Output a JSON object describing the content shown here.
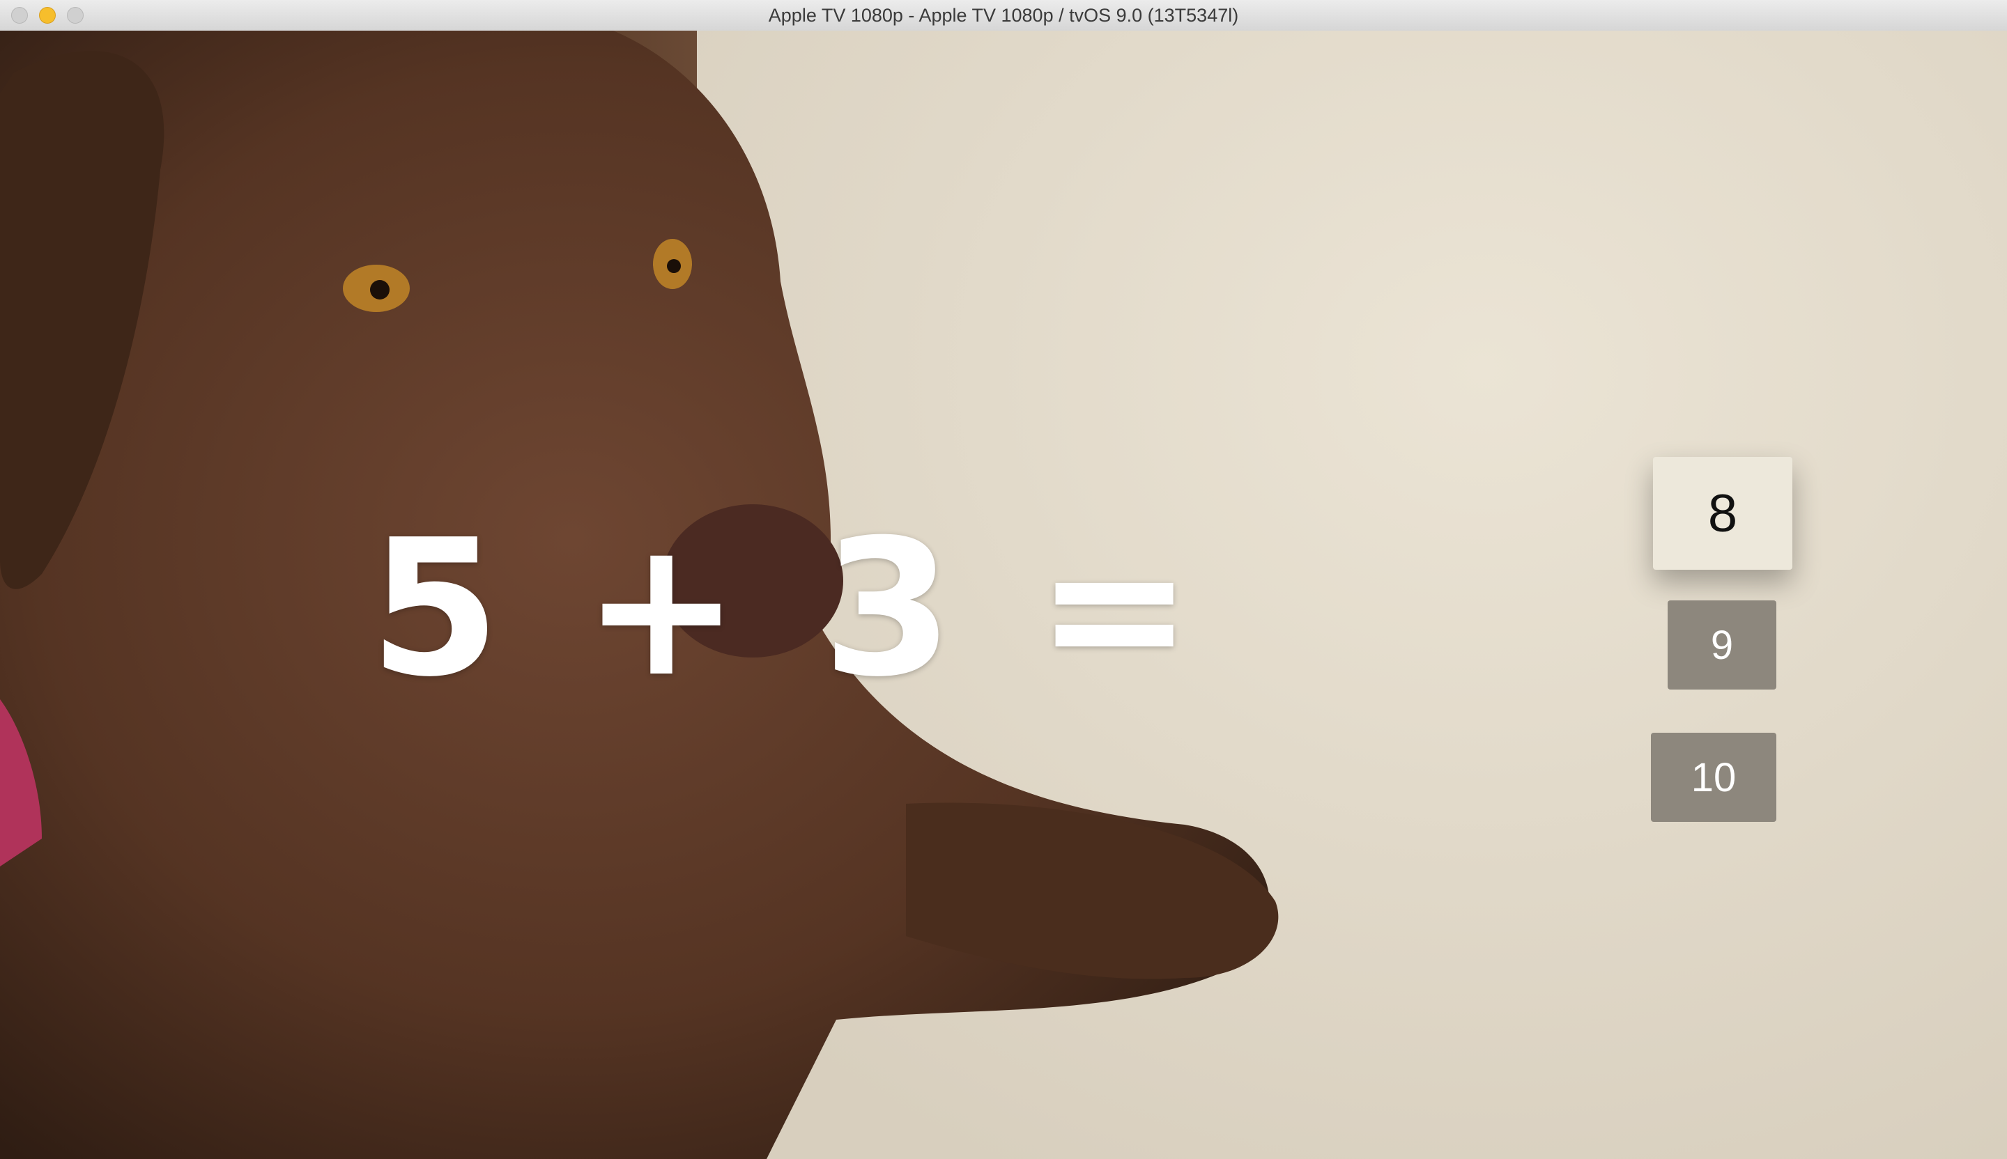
{
  "window": {
    "title": "Apple TV 1080p - Apple TV 1080p / tvOS 9.0 (13T5347l)"
  },
  "quiz": {
    "equation": "5 + 3 =",
    "answers": [
      "8",
      "9",
      "10"
    ],
    "focused_answer": "8"
  },
  "background": {
    "description_icon": "dog-photo"
  },
  "colors": {
    "answer_focused": "#ede8db",
    "answer_default": "#8d877d",
    "equation_text": "#ffffff"
  }
}
